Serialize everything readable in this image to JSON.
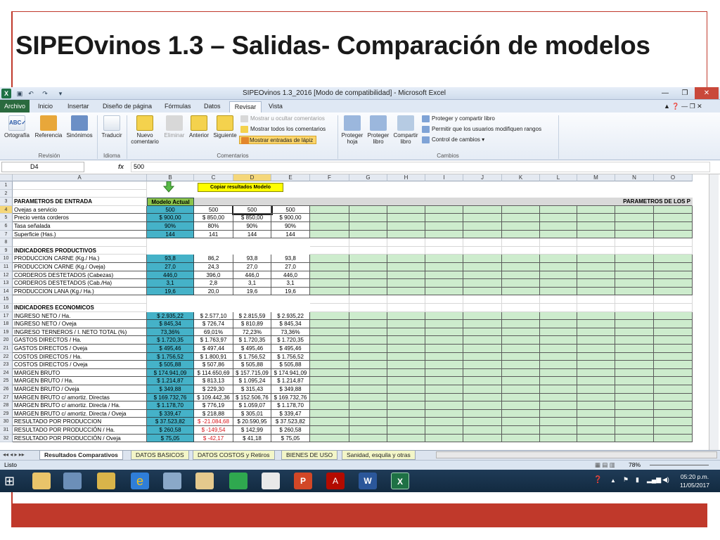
{
  "slide": {
    "title": "SIPEOvinos 1.3 – Salidas- Comparación de modelos"
  },
  "excel": {
    "window_title": "SIPEOvinos 1.3_2016  [Modo de compatibilidad]  -  Microsoft Excel",
    "tabs": [
      "Archivo",
      "Inicio",
      "Insertar",
      "Diseño de página",
      "Fórmulas",
      "Datos",
      "Revisar",
      "Vista"
    ],
    "active_tab": "Revisar",
    "ribbon": {
      "revision": {
        "label": "Revisión",
        "ortografia": "Ortografía",
        "referencia": "Referencia",
        "sinonimos": "Sinónimos"
      },
      "idioma": {
        "label": "Idioma",
        "traducir": "Traducir"
      },
      "comentarios": {
        "label": "Comentarios",
        "nuevo": "Nuevo comentario",
        "eliminar": "Eliminar",
        "anterior": "Anterior",
        "siguiente": "Siguiente",
        "mostrar_ocultar": "Mostrar u ocultar comentarios",
        "mostrar_todos": "Mostrar todos los comentarios",
        "mostrar_lapiz": "Mostrar entradas de lápiz"
      },
      "cambios": {
        "label": "Cambios",
        "proteger_hoja": "Proteger hoja",
        "proteger_libro": "Proteger libro",
        "compartir_libro": "Compartir libro",
        "proteger_compartir": "Proteger y compartir libro",
        "permitir": "Permitir que los usuarios modifiquen rangos",
        "control": "Control de cambios ▾"
      }
    },
    "formula": {
      "cell": "D4",
      "fx": "fx",
      "value": "500"
    },
    "columns": [
      "A",
      "B",
      "C",
      "D",
      "E",
      "F",
      "G",
      "H",
      "I",
      "J",
      "K",
      "L",
      "M",
      "N",
      "O"
    ],
    "copy_button": "Copiar resultados Modelo",
    "modelo_actual": "Modelo Actual",
    "parametros_right": "PARAMETROS DE LOS P",
    "rows": [
      {
        "n": "1",
        "a": "",
        "v": []
      },
      {
        "n": "2",
        "a": "",
        "v": []
      },
      {
        "n": "3",
        "a": "PARAMETROS DE ENTRADA",
        "h": true,
        "v": []
      },
      {
        "n": "4",
        "a": "Ovejas a servicio",
        "v": [
          "500",
          "500",
          "500",
          "500"
        ]
      },
      {
        "n": "5",
        "a": "Precio venta corderos",
        "v": [
          "$ 900,00",
          "$ 850,00",
          "$ 850,00",
          "$ 900,00"
        ]
      },
      {
        "n": "6",
        "a": "Tasa señalada",
        "v": [
          "90%",
          "80%",
          "90%",
          "90%"
        ]
      },
      {
        "n": "7",
        "a": "Superficie (Has.)",
        "v": [
          "144",
          "141",
          "144",
          "144"
        ]
      },
      {
        "n": "8",
        "a": "",
        "v": []
      },
      {
        "n": "9",
        "a": "INDICADORES PRODUCTIVOS",
        "h": true,
        "v": []
      },
      {
        "n": "10",
        "a": "PRODUCCION CARNE (Kg./ Ha.)",
        "v": [
          "93,8",
          "86,2",
          "93,8",
          "93,8"
        ]
      },
      {
        "n": "11",
        "a": "PRODUCCION CARNE (Kg./ Oveja)",
        "v": [
          "27,0",
          "24,3",
          "27,0",
          "27,0"
        ]
      },
      {
        "n": "12",
        "a": "CORDEROS DESTETADOS (Cabezas)",
        "v": [
          "446,0",
          "396,0",
          "446,0",
          "446,0"
        ]
      },
      {
        "n": "13",
        "a": "CORDEROS DESTETADOS (Cab./Ha)",
        "v": [
          "3,1",
          "2,8",
          "3,1",
          "3,1"
        ]
      },
      {
        "n": "14",
        "a": "PRODUCCION LANA (Kg./ Ha.)",
        "v": [
          "19,6",
          "20,0",
          "19,6",
          "19,6"
        ]
      },
      {
        "n": "15",
        "a": "",
        "v": []
      },
      {
        "n": "16",
        "a": "INDICADORES ECONOMICOS",
        "h": true,
        "v": []
      },
      {
        "n": "17",
        "a": "INGRESO NETO / Ha.",
        "v": [
          "$ 2.935,22",
          "$ 2.577,10",
          "$ 2.815,59",
          "$ 2.935,22"
        ]
      },
      {
        "n": "18",
        "a": "INGRESO NETO / Oveja",
        "v": [
          "$ 845,34",
          "$ 726,74",
          "$ 810,89",
          "$ 845,34"
        ]
      },
      {
        "n": "19",
        "a": "INGRESO TERNEROS / I. NETO TOTAL (%)",
        "v": [
          "73,36%",
          "69,01%",
          "72,23%",
          "73,36%"
        ]
      },
      {
        "n": "20",
        "a": "GASTOS DIRECTOS / Ha.",
        "v": [
          "$ 1.720,35",
          "$ 1.763,97",
          "$ 1.720,35",
          "$ 1.720,35"
        ]
      },
      {
        "n": "21",
        "a": "GASTOS DIRECTOS / Oveja",
        "v": [
          "$ 495,46",
          "$ 497,44",
          "$ 495,46",
          "$ 495,46"
        ]
      },
      {
        "n": "22",
        "a": "COSTOS DIRECTOS / Ha.",
        "v": [
          "$ 1.756,52",
          "$ 1.800,91",
          "$ 1.756,52",
          "$ 1.756,52"
        ]
      },
      {
        "n": "23",
        "a": "COSTOS DIRECTOS / Oveja",
        "v": [
          "$ 505,88",
          "$ 507,86",
          "$ 505,88",
          "$ 505,88"
        ]
      },
      {
        "n": "24",
        "a": "MARGEN BRUTO",
        "v": [
          "$ 174.941,09",
          "$ 114.650,69",
          "$ 157.715,09",
          "$ 174.941,09"
        ]
      },
      {
        "n": "25",
        "a": "MARGEN BRUTO / Ha.",
        "v": [
          "$ 1.214,87",
          "$ 813,13",
          "$ 1.095,24",
          "$ 1.214,87"
        ]
      },
      {
        "n": "26",
        "a": "MARGEN BRUTO / Oveja",
        "v": [
          "$ 349,88",
          "$ 229,30",
          "$ 315,43",
          "$ 349,88"
        ]
      },
      {
        "n": "27",
        "a": "MARGEN BRUTO c/ amortiz. Directas",
        "v": [
          "$ 169.732,76",
          "$ 109.442,36",
          "$ 152.506,76",
          "$ 169.732,76"
        ]
      },
      {
        "n": "28",
        "a": "MARGEN BRUTO c/ amortiz. Directa / Ha.",
        "v": [
          "$ 1.178,70",
          "$ 776,19",
          "$ 1.059,07",
          "$ 1.178,70"
        ]
      },
      {
        "n": "29",
        "a": "MARGEN BRUTO c/ amortiz. Directa / Oveja",
        "v": [
          "$ 339,47",
          "$ 218,88",
          "$ 305,01",
          "$ 339,47"
        ]
      },
      {
        "n": "30",
        "a": "RESULTADO POR PRODUCCION",
        "v": [
          "$ 37.523,82",
          "$ -21.084,68",
          "$ 20.590,95",
          "$ 37.523,82"
        ],
        "red": [
          1
        ]
      },
      {
        "n": "31",
        "a": "RESULTADO POR PRODUCCIÓN / Ha.",
        "v": [
          "$ 260,58",
          "$ -149,54",
          "$ 142,99",
          "$ 260,58"
        ],
        "red": [
          1
        ]
      },
      {
        "n": "32",
        "a": "RESULTADO POR PRODUCCIÓN / Oveja",
        "v": [
          "$ 75,05",
          "$ -42,17",
          "$ 41,18",
          "$ 75,05"
        ],
        "red": [
          1
        ]
      }
    ],
    "sheets": [
      "Resultados Comparativos",
      "DATOS BASICOS",
      "DATOS COSTOS y Retiros",
      "BIENES DE USO",
      "Sanidad, esquila y otras"
    ],
    "status": "Listo",
    "zoom": "78%",
    "clock": {
      "time": "05:20 p.m.",
      "date": "11/05/2017"
    }
  },
  "colors": {
    "green": "#cdeccd",
    "teal": "#45b2c8",
    "accent": "#c0392b"
  }
}
